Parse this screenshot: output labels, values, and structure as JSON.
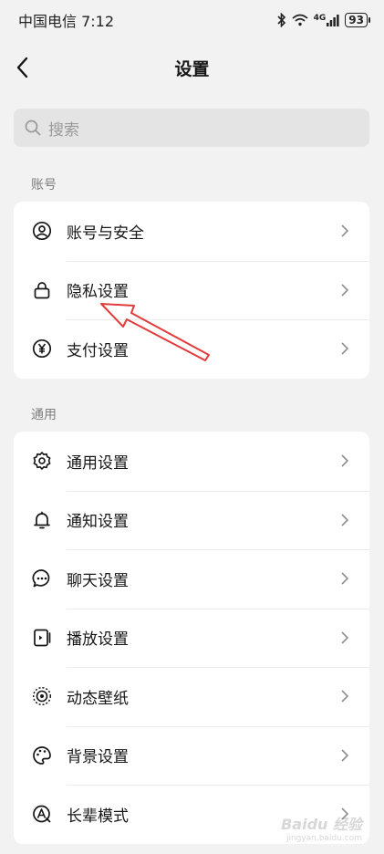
{
  "status_bar": {
    "carrier_time": "中国电信 7:12",
    "network": "4G",
    "battery": "93"
  },
  "header": {
    "title": "设置"
  },
  "search": {
    "placeholder": "搜索"
  },
  "sections": [
    {
      "label": "账号",
      "items": [
        {
          "label": "账号与安全",
          "icon": "account-security-icon"
        },
        {
          "label": "隐私设置",
          "icon": "lock-icon"
        },
        {
          "label": "支付设置",
          "icon": "yuan-icon"
        }
      ]
    },
    {
      "label": "通用",
      "items": [
        {
          "label": "通用设置",
          "icon": "gear-icon"
        },
        {
          "label": "通知设置",
          "icon": "bell-icon"
        },
        {
          "label": "聊天设置",
          "icon": "chat-bubble-icon"
        },
        {
          "label": "播放设置",
          "icon": "play-device-icon"
        },
        {
          "label": "动态壁纸",
          "icon": "dynamic-wallpaper-icon"
        },
        {
          "label": "背景设置",
          "icon": "palette-icon"
        },
        {
          "label": "长辈模式",
          "icon": "elder-mode-icon"
        }
      ]
    }
  ],
  "annotation": {
    "arrow_color": "#e23b3b"
  },
  "watermark": {
    "text": "Baidu 经验",
    "sub": "jingyan.baidu.com"
  }
}
